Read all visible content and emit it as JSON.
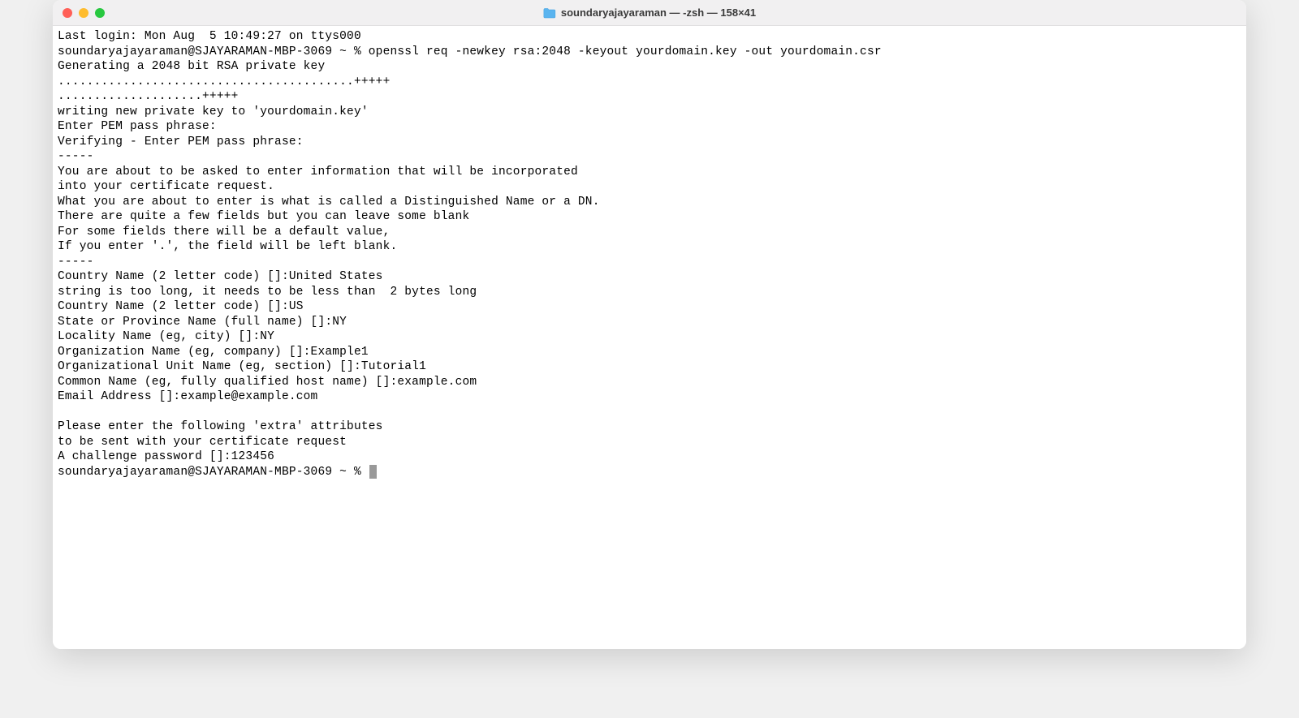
{
  "titlebar": {
    "title": "soundaryajayaraman — -zsh — 158×41"
  },
  "terminal": {
    "lines": [
      "Last login: Mon Aug  5 10:49:27 on ttys000",
      "soundaryajayaraman@SJAYARAMAN-MBP-3069 ~ % openssl req -newkey rsa:2048 -keyout yourdomain.key -out yourdomain.csr",
      "Generating a 2048 bit RSA private key",
      ".........................................+++++",
      "....................+++++",
      "writing new private key to 'yourdomain.key'",
      "Enter PEM pass phrase:",
      "Verifying - Enter PEM pass phrase:",
      "-----",
      "You are about to be asked to enter information that will be incorporated",
      "into your certificate request.",
      "What you are about to enter is what is called a Distinguished Name or a DN.",
      "There are quite a few fields but you can leave some blank",
      "For some fields there will be a default value,",
      "If you enter '.', the field will be left blank.",
      "-----",
      "Country Name (2 letter code) []:United States",
      "string is too long, it needs to be less than  2 bytes long",
      "Country Name (2 letter code) []:US",
      "State or Province Name (full name) []:NY",
      "Locality Name (eg, city) []:NY",
      "Organization Name (eg, company) []:Example1",
      "Organizational Unit Name (eg, section) []:Tutorial1",
      "Common Name (eg, fully qualified host name) []:example.com",
      "Email Address []:example@example.com",
      "",
      "Please enter the following 'extra' attributes",
      "to be sent with your certificate request",
      "A challenge password []:123456"
    ],
    "prompt": "soundaryajayaraman@SJAYARAMAN-MBP-3069 ~ % "
  }
}
